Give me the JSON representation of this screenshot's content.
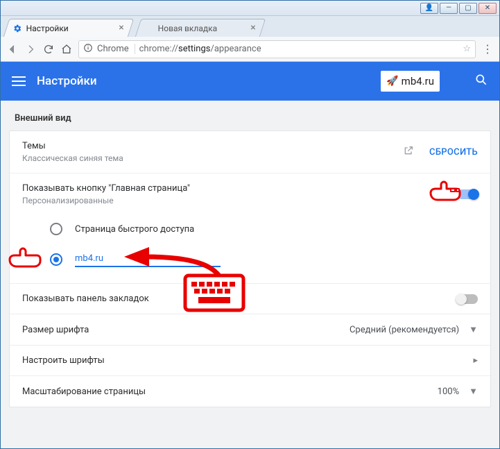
{
  "window": {
    "user_btn": "👤",
    "min": "—",
    "max": "▢",
    "close": "✕"
  },
  "tabs": [
    {
      "title": "Настройки",
      "active": true
    },
    {
      "title": "Новая вкладка",
      "active": false
    }
  ],
  "omnibox": {
    "prefix": "Chrome",
    "scheme": "chrome://",
    "bold": "settings",
    "rest": "/appearance"
  },
  "header": {
    "title": "Настройки",
    "logo_text": "mb4.ru"
  },
  "section": {
    "title": "Внешний вид",
    "themes": {
      "primary": "Темы",
      "secondary": "Классическая синяя тема",
      "action": "СБРОСИТЬ"
    },
    "homepage": {
      "primary": "Показывать кнопку \"Главная страница\"",
      "secondary": "Персонализированные",
      "toggle": true
    },
    "radio": {
      "option1": "Страница быстрого доступа",
      "option2_value": "mb4.ru"
    },
    "bookmarks": {
      "primary": "Показывать панель закладок",
      "toggle": false
    },
    "fontsize": {
      "primary": "Размер шрифта",
      "value": "Средний (рекомендуется)"
    },
    "customfonts": {
      "primary": "Настроить шрифты"
    },
    "zoom": {
      "primary": "Масштабирование страницы",
      "value": "100%"
    }
  }
}
